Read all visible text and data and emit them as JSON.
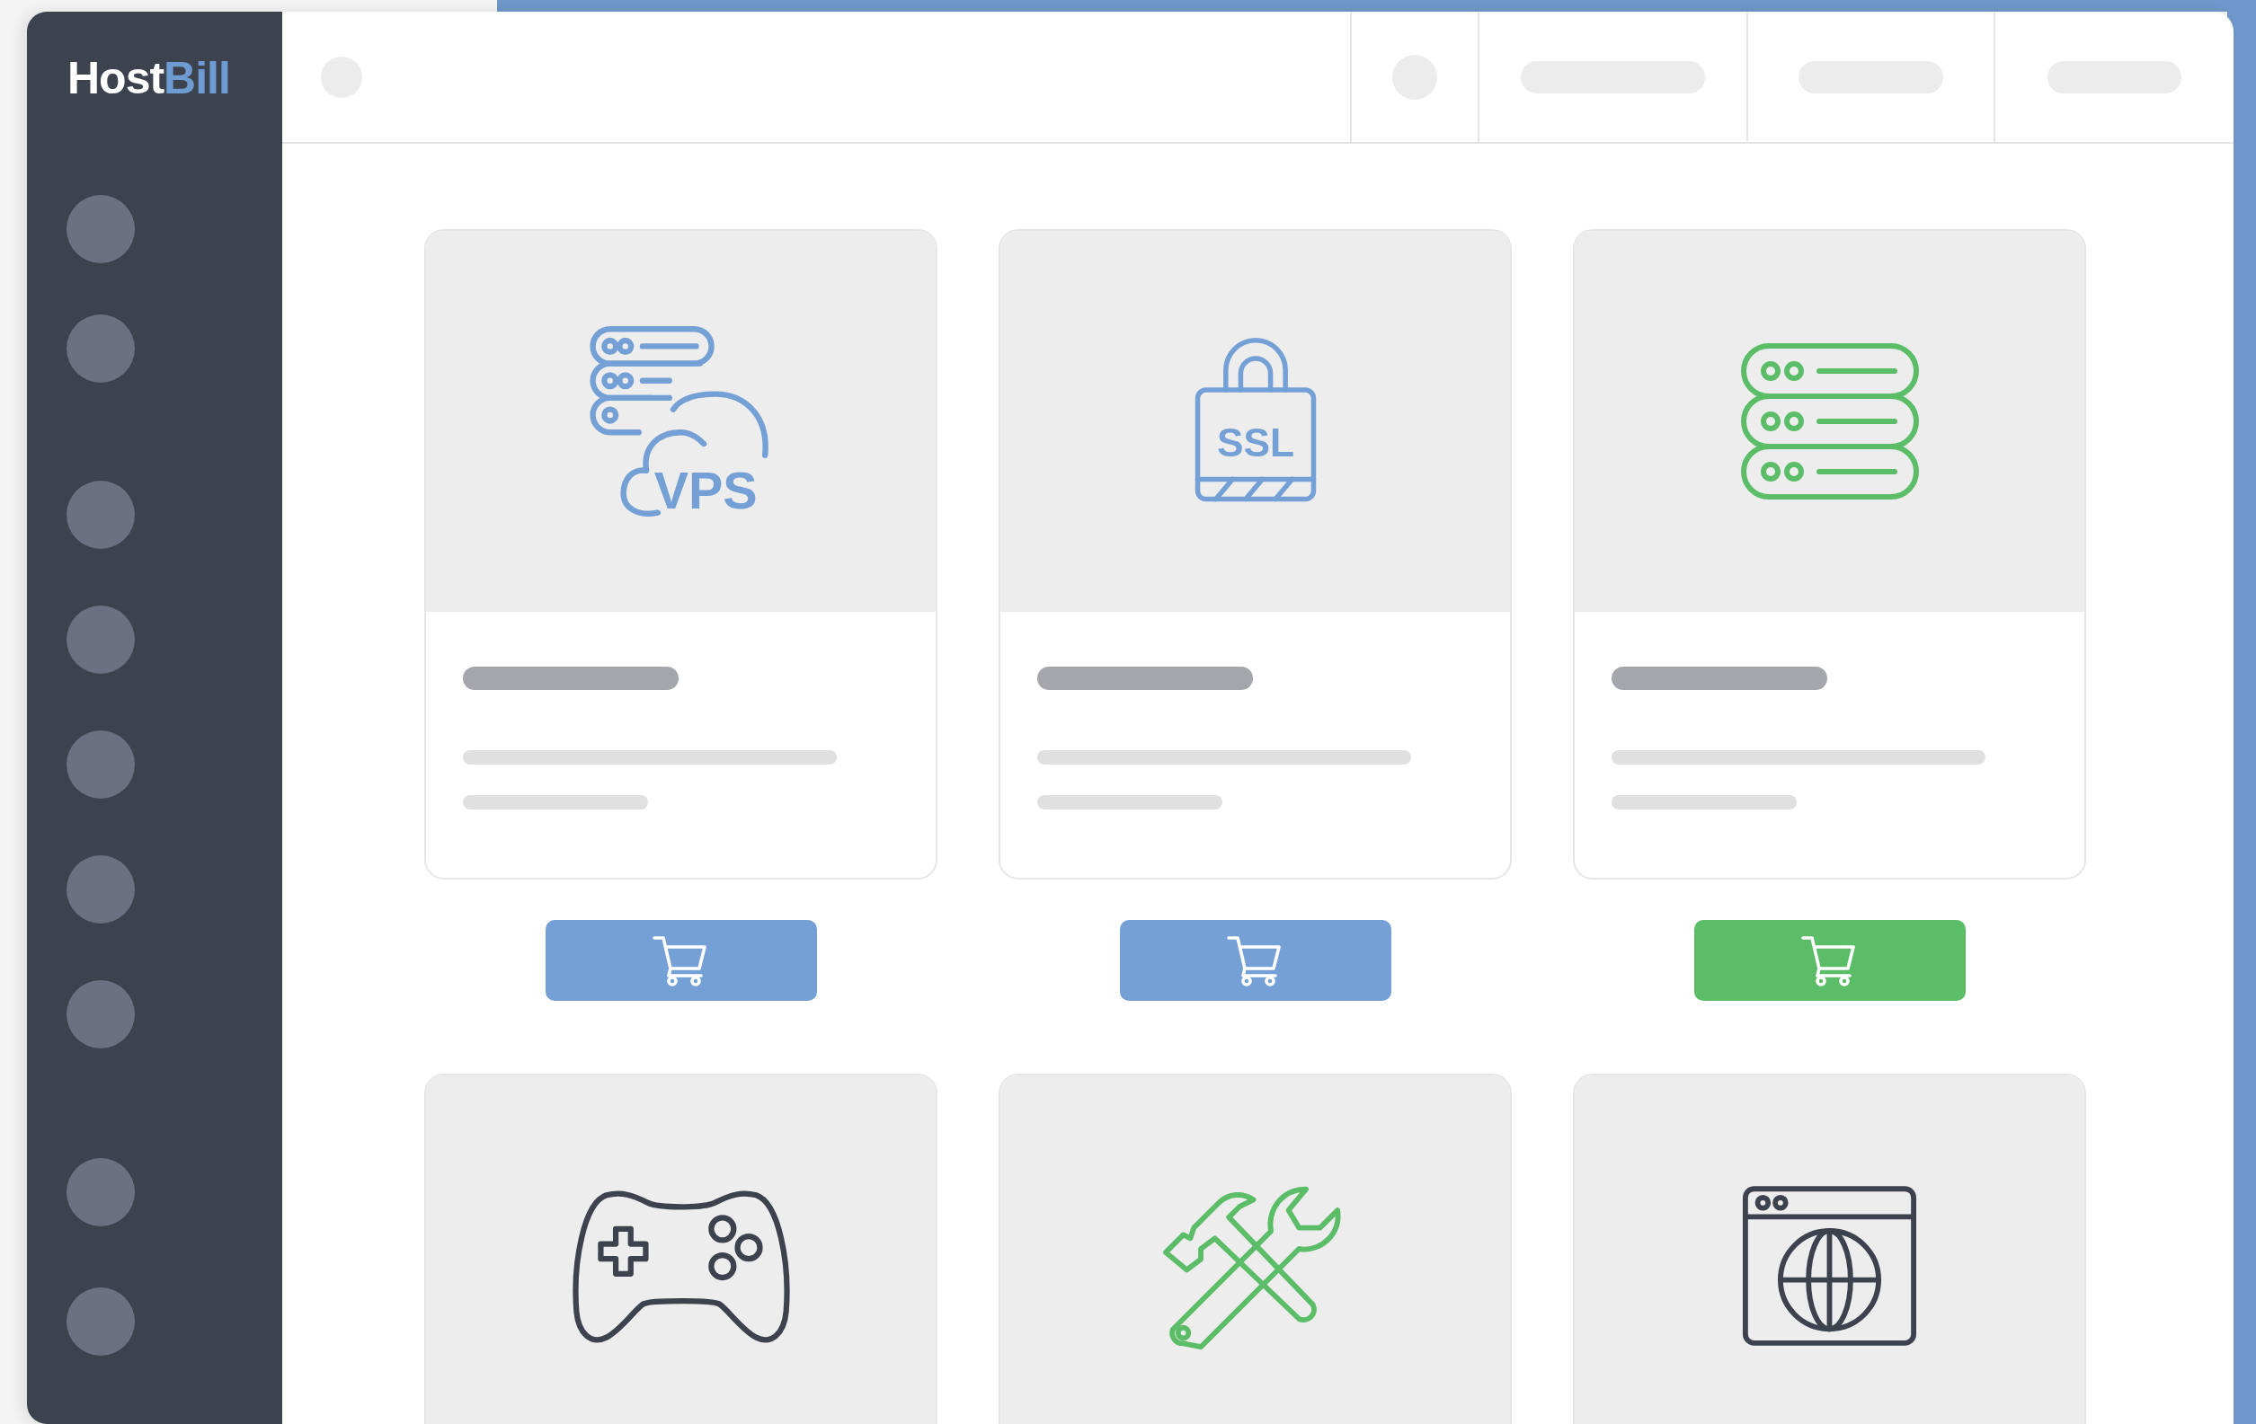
{
  "logo": {
    "first": "Host",
    "second": "Bill"
  },
  "card_rows": [
    {
      "cards": [
        {
          "kind": "vps",
          "label": "VPS",
          "color": "#74a0d6",
          "button": {
            "kind": "cart"
          }
        },
        {
          "kind": "ssl",
          "label": "SSL",
          "color": "#74a0d6",
          "button": {
            "kind": "cart"
          }
        },
        {
          "kind": "servers",
          "color": "#5cbd68",
          "button": {
            "kind": "cart"
          }
        }
      ]
    },
    {
      "cards": [
        {
          "kind": "gamepad",
          "color": "#3d434e"
        },
        {
          "kind": "tools",
          "color": "#5cbd68"
        },
        {
          "kind": "globe",
          "color": "#3d434e"
        }
      ]
    }
  ]
}
